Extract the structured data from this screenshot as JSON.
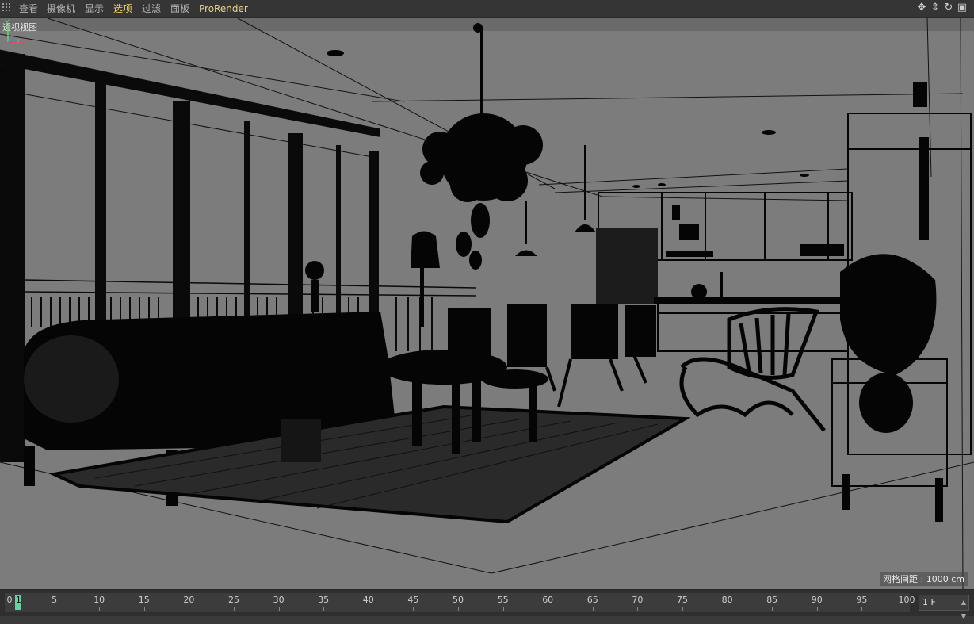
{
  "menubar": {
    "items": [
      "查看",
      "摄像机",
      "显示",
      "选项",
      "过滤",
      "面板",
      "ProRender"
    ],
    "active": "选项"
  },
  "nav_icons": [
    "move-view-icon",
    "dolly-view-icon",
    "rotate-view-icon",
    "toggle-view-icon"
  ],
  "viewport": {
    "name": "透视视图",
    "grid_spacing": "网格间距 : 1000 cm",
    "axis": {
      "y": "Y",
      "z": "Z",
      "x": "X"
    },
    "background": "#7c7c7c"
  },
  "timeline": {
    "ticks": [
      "0",
      "5",
      "10",
      "15",
      "20",
      "25",
      "30",
      "35",
      "40",
      "45",
      "50",
      "55",
      "60",
      "65",
      "70",
      "75",
      "80",
      "85",
      "90",
      "95",
      "100"
    ],
    "current_frame": "1",
    "frame_field": "1 F",
    "playhead_color": "#5fd6a0"
  }
}
